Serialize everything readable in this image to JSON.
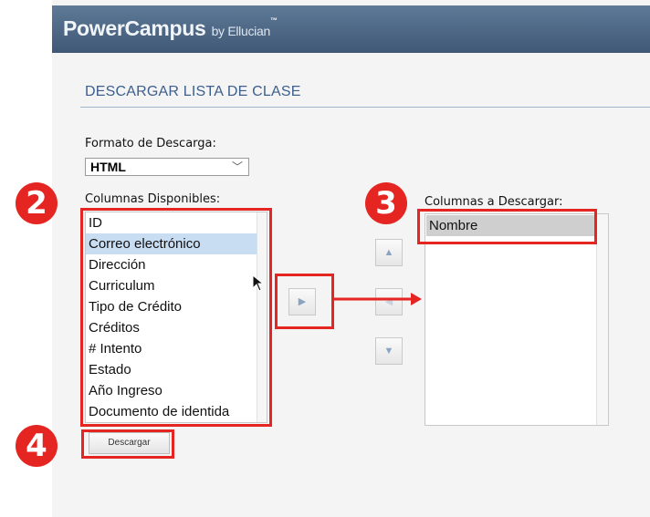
{
  "header": {
    "brand": "PowerCampus",
    "by": "by Ellucian",
    "tm": "™"
  },
  "page": {
    "title": "DESCARGAR LISTA DE CLASE"
  },
  "format": {
    "label": "Formato de Descarga:",
    "selected": "HTML"
  },
  "available": {
    "label": "Columnas Disponibles:",
    "items": [
      "ID",
      "Correo electrónico",
      "Dirección",
      "Curriculum",
      "Tipo de Crédito",
      "Créditos",
      "# Intento",
      "Estado",
      "Año Ingreso",
      "Documento de identida"
    ]
  },
  "download_cols": {
    "label": "Columnas a Descargar:",
    "items": [
      "Nombre"
    ]
  },
  "buttons": {
    "download": "Descargar",
    "up": "▲",
    "right": "▶",
    "left": "◀",
    "down": "▼"
  },
  "badges": {
    "b2": "2",
    "b3": "3",
    "b4": "4"
  },
  "colors": {
    "header": "#4f6a88",
    "title": "#3d5f8c",
    "annotation": "#e52521",
    "selection": "#c8dcf2"
  }
}
